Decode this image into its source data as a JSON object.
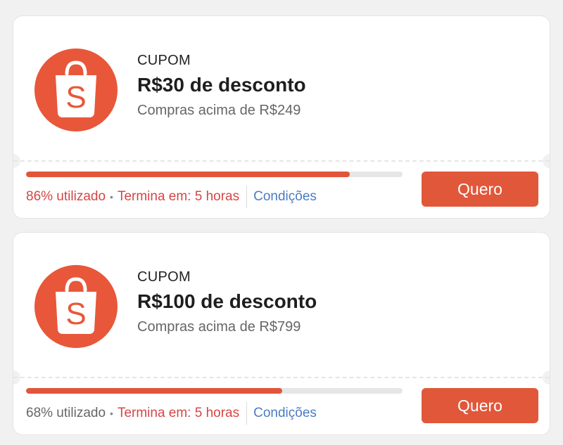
{
  "colors": {
    "brand": "#e8573a",
    "button": "#e1573a",
    "progress_fill": "#e2553a",
    "warning_text": "#d64545",
    "link": "#4a7cc4"
  },
  "coupons": [
    {
      "logo_icon": "shopee-bag-icon",
      "label": "CUPOM",
      "title": "R$30 de desconto",
      "subtitle": "Compras acima de R$249",
      "used_percent": 86,
      "used_text": "86% utilizado",
      "bullet": "•",
      "ends_text": "Termina em: 5 horas",
      "conditions_label": "Condições",
      "button_label": "Quero"
    },
    {
      "logo_icon": "shopee-bag-icon",
      "label": "CUPOM",
      "title": "R$100 de desconto",
      "subtitle": "Compras acima de R$799",
      "used_percent": 68,
      "used_text": "68% utilizado",
      "bullet": "•",
      "ends_text": "Termina em: 5 horas",
      "conditions_label": "Condições",
      "button_label": "Quero"
    }
  ]
}
